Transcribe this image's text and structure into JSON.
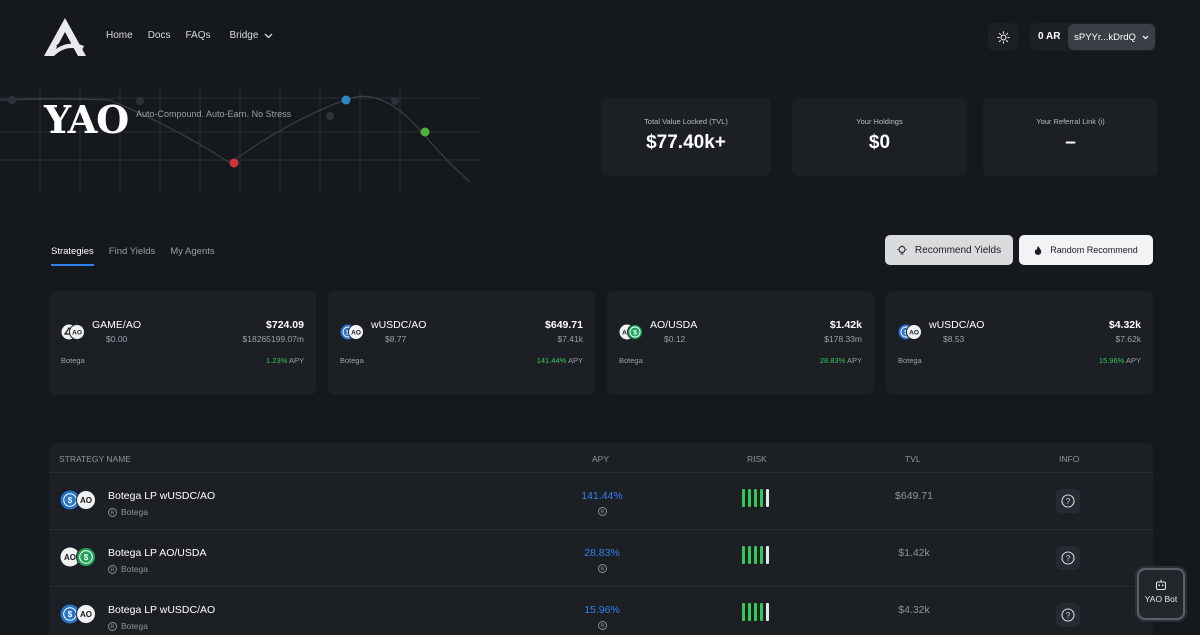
{
  "nav": {
    "home": "Home",
    "docs": "Docs",
    "faqs": "FAQs",
    "bridge": "Bridge"
  },
  "wallet": {
    "balance": "0 AR",
    "address": "sPYYr...kDrdQ"
  },
  "hero": {
    "brand": "YAO",
    "tagline": "Auto-Compound. Auto-Earn. No Stress"
  },
  "stats": [
    {
      "label": "Total Value Locked (TVL)",
      "value": "$77.40k+"
    },
    {
      "label": "Your Holdings",
      "value": "$0"
    },
    {
      "label": "Your Referral Link (i)",
      "value": "–"
    }
  ],
  "tabs": [
    "Strategies",
    "Find Yields",
    "My Agents"
  ],
  "actions": {
    "recommend": "Recommend Yields",
    "random": "Random Recommend"
  },
  "cards": [
    {
      "pair": "GAME/AO",
      "price": "$0.00",
      "amount": "$724.09",
      "sub": "$18265199.07m",
      "provider": "Botega",
      "apy": "1.23%",
      "apy_suffix": "APY",
      "icon": "game-ao-pair-icon"
    },
    {
      "pair": "wUSDC/AO",
      "price": "$8.77",
      "amount": "$649.71",
      "sub": "$7.41k",
      "provider": "Botega",
      "apy": "141.44%",
      "apy_suffix": "APY",
      "icon": "wusdc-ao-pair-icon"
    },
    {
      "pair": "AO/USDA",
      "price": "$0.12",
      "amount": "$1.42k",
      "sub": "$178.33m",
      "provider": "Botega",
      "apy": "28.83%",
      "apy_suffix": "APY",
      "icon": "ao-usda-pair-icon"
    },
    {
      "pair": "wUSDC/AO",
      "price": "$8.53",
      "amount": "$4.32k",
      "sub": "$7.62k",
      "provider": "Botega",
      "apy": "15.96%",
      "apy_suffix": "APY",
      "icon": "wusdc-ao-pair-icon"
    }
  ],
  "table": {
    "headers": {
      "name": "STRATEGY NAME",
      "apy": "APY",
      "risk": "RISK",
      "tvl": "TVL",
      "info": "INFO"
    },
    "rows": [
      {
        "name": "Botega LP wUSDC/AO",
        "provider": "Botega",
        "apy": "141.44%",
        "tvl": "$649.71",
        "risk_level": 4,
        "risk_max": 5
      },
      {
        "name": "Botega LP AO/USDA",
        "provider": "Botega",
        "apy": "28.83%",
        "tvl": "$1.42k",
        "risk_level": 4,
        "risk_max": 5
      },
      {
        "name": "Botega LP wUSDC/AO",
        "provider": "Botega",
        "apy": "15.96%",
        "tvl": "$4.32k",
        "risk_level": 4,
        "risk_max": 5
      }
    ]
  },
  "bot": {
    "label": "YAO Bot"
  },
  "colors": {
    "background": "#15181c",
    "panel": "#1c2025",
    "accent_blue": "#2f80ed",
    "apy_green": "#35c759",
    "usdc_blue": "#2775ca",
    "usda_green": "#21a35b"
  }
}
